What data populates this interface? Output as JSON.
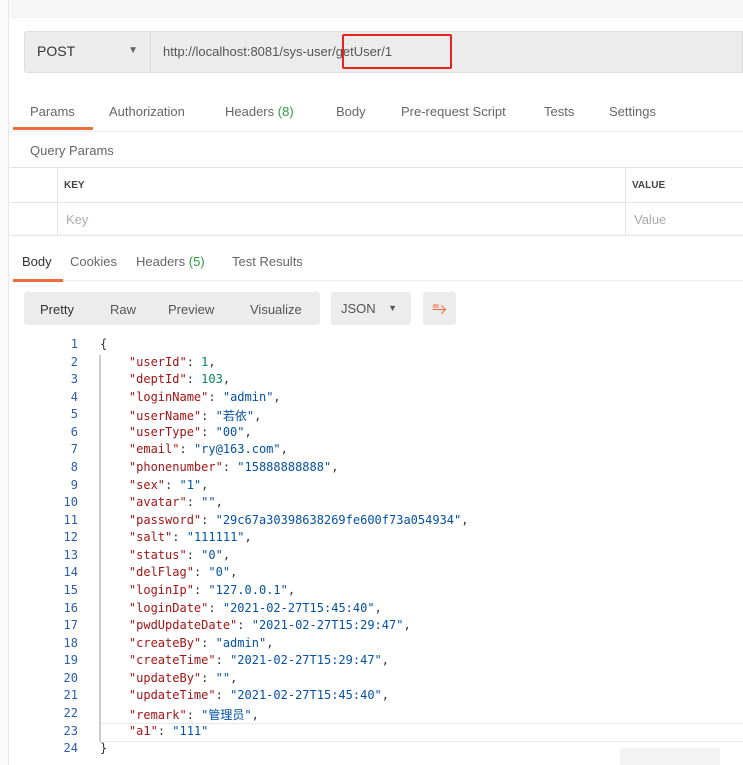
{
  "request": {
    "method": "POST",
    "url": "http://localhost:8081/sys-user/getUser/1",
    "highlight_color": "#e8231b"
  },
  "req_tabs": [
    {
      "label": "Params"
    },
    {
      "label": "Authorization"
    },
    {
      "label": "Headers",
      "count": "(8)"
    },
    {
      "label": "Body"
    },
    {
      "label": "Pre-request Script"
    },
    {
      "label": "Tests"
    },
    {
      "label": "Settings"
    }
  ],
  "query": {
    "title": "Query Params",
    "key_header": "KEY",
    "value_header": "VALUE",
    "key_placeholder": "Key",
    "value_placeholder": "Value"
  },
  "resp_tabs": [
    {
      "label": "Body"
    },
    {
      "label": "Cookies"
    },
    {
      "label": "Headers",
      "count": "(5)"
    },
    {
      "label": "Test Results"
    }
  ],
  "view": {
    "buttons": [
      "Pretty",
      "Raw",
      "Preview",
      "Visualize"
    ],
    "format": "JSON",
    "wrap_icon": "wrap-lines-icon"
  },
  "accent": "#f26b3a",
  "code": {
    "open": "{",
    "close": "}",
    "entries": [
      {
        "k": "\"userId\"",
        "v": "1",
        "t": "n"
      },
      {
        "k": "\"deptId\"",
        "v": "103",
        "t": "n"
      },
      {
        "k": "\"loginName\"",
        "v": "\"admin\"",
        "t": "s"
      },
      {
        "k": "\"userName\"",
        "v": "\"若依\"",
        "t": "s"
      },
      {
        "k": "\"userType\"",
        "v": "\"00\"",
        "t": "s"
      },
      {
        "k": "\"email\"",
        "v": "\"ry@163.com\"",
        "t": "s"
      },
      {
        "k": "\"phonenumber\"",
        "v": "\"15888888888\"",
        "t": "s"
      },
      {
        "k": "\"sex\"",
        "v": "\"1\"",
        "t": "s"
      },
      {
        "k": "\"avatar\"",
        "v": "\"\"",
        "t": "s"
      },
      {
        "k": "\"password\"",
        "v": "\"29c67a30398638269fe600f73a054934\"",
        "t": "s"
      },
      {
        "k": "\"salt\"",
        "v": "\"111111\"",
        "t": "s"
      },
      {
        "k": "\"status\"",
        "v": "\"0\"",
        "t": "s"
      },
      {
        "k": "\"delFlag\"",
        "v": "\"0\"",
        "t": "s"
      },
      {
        "k": "\"loginIp\"",
        "v": "\"127.0.0.1\"",
        "t": "s"
      },
      {
        "k": "\"loginDate\"",
        "v": "\"2021-02-27T15:45:40\"",
        "t": "s"
      },
      {
        "k": "\"pwdUpdateDate\"",
        "v": "\"2021-02-27T15:29:47\"",
        "t": "s"
      },
      {
        "k": "\"createBy\"",
        "v": "\"admin\"",
        "t": "s"
      },
      {
        "k": "\"createTime\"",
        "v": "\"2021-02-27T15:29:47\"",
        "t": "s"
      },
      {
        "k": "\"updateBy\"",
        "v": "\"\"",
        "t": "s"
      },
      {
        "k": "\"updateTime\"",
        "v": "\"2021-02-27T15:45:40\"",
        "t": "s"
      },
      {
        "k": "\"remark\"",
        "v": "\"管理员\"",
        "t": "s"
      },
      {
        "k": "\"a1\"",
        "v": "\"111\"",
        "t": "s"
      }
    ]
  }
}
